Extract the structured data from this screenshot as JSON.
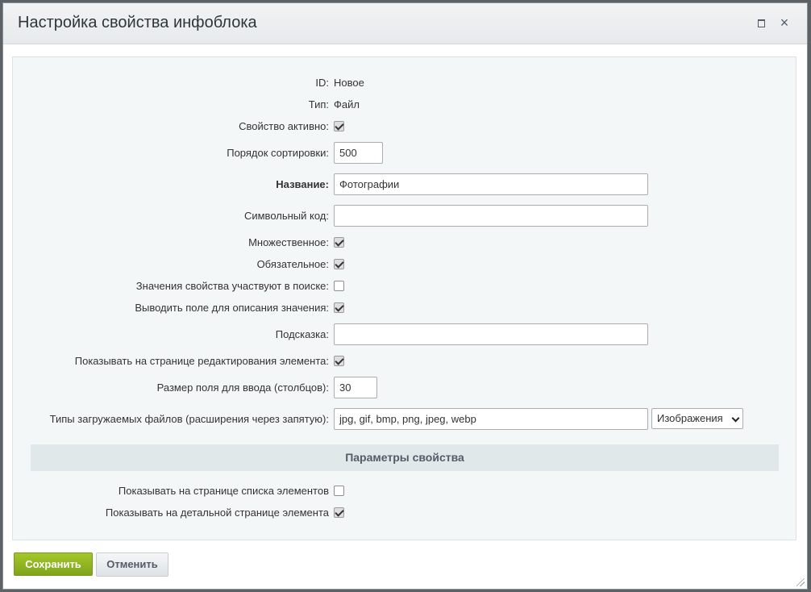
{
  "dialog": {
    "title": "Настройка свойства инфоблока",
    "maximize_icon": "maximize-icon",
    "close_icon": "close-icon",
    "close_glyph": "×"
  },
  "form": {
    "id": {
      "label": "ID:",
      "value": "Новое"
    },
    "type": {
      "label": "Тип:",
      "value": "Файл"
    },
    "active": {
      "label": "Свойство активно:",
      "checked": true
    },
    "sort": {
      "label": "Порядок сортировки:",
      "value": "500"
    },
    "name": {
      "label": "Название:",
      "value": "Фотографии"
    },
    "code": {
      "label": "Символьный код:",
      "value": ""
    },
    "multiple": {
      "label": "Множественное:",
      "checked": true
    },
    "required": {
      "label": "Обязательное:",
      "checked": true
    },
    "searchable": {
      "label": "Значения свойства участвуют в поиске:",
      "checked": false
    },
    "with_description": {
      "label": "Выводить поле для описания значения:",
      "checked": true
    },
    "hint": {
      "label": "Подсказка:",
      "value": ""
    },
    "show_on_edit": {
      "label": "Показывать на странице редактирования элемента:",
      "checked": true
    },
    "col_count": {
      "label": "Размер поля для ввода (столбцов):",
      "value": "30"
    },
    "file_types": {
      "label": "Типы загружаемых файлов (расширения через запятую):",
      "value": "jpg, gif, bmp, png, jpeg, webp",
      "preset": "Изображения"
    }
  },
  "section": {
    "title": "Параметры свойства",
    "show_in_list": {
      "label": "Показывать на странице списка элементов",
      "checked": false
    },
    "show_in_detail": {
      "label": "Показывать на детальной странице элемента",
      "checked": true
    }
  },
  "buttons": {
    "save": "Сохранить",
    "cancel": "Отменить"
  }
}
